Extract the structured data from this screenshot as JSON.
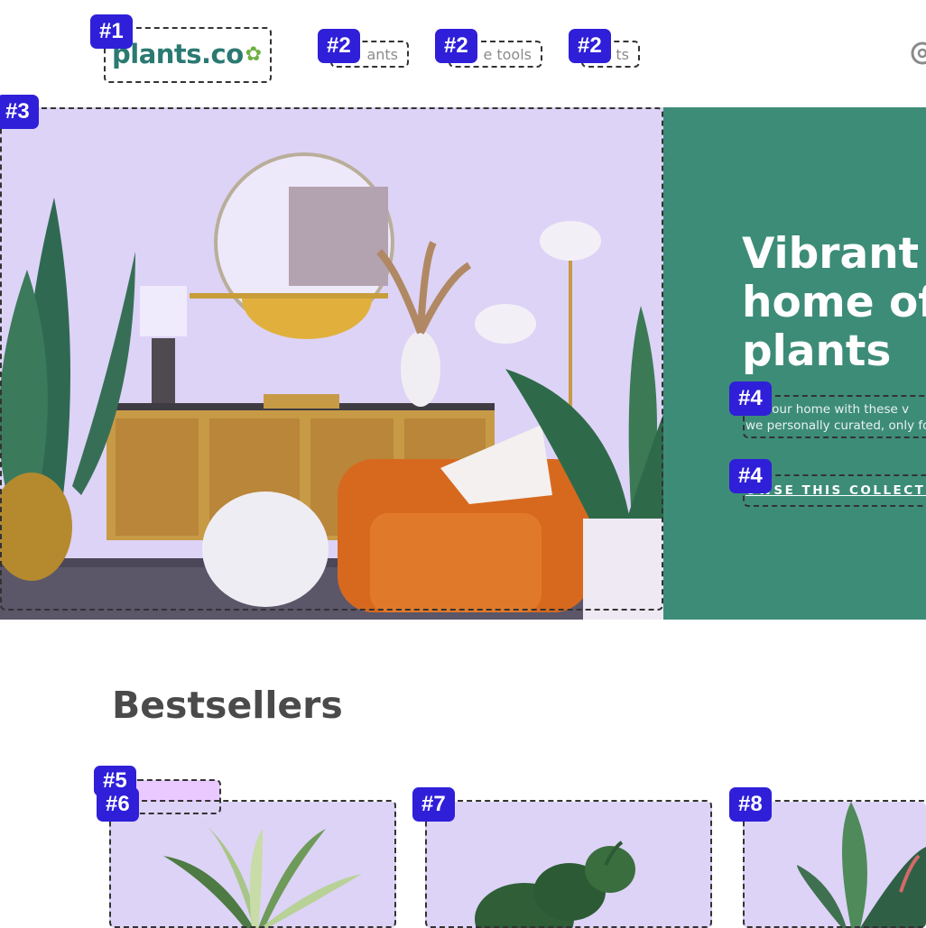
{
  "header": {
    "logo_text": "plants.co",
    "nav": [
      "ants",
      "e tools",
      "ts"
    ]
  },
  "hero": {
    "title": "Vibrant\nhome off\nplants",
    "description": "en your home with these v\nwe personally curated, only for",
    "cta": "OWSE THIS COLLECTI"
  },
  "bestsellers": {
    "title": "Bestsellers"
  },
  "badges": [
    "#1",
    "#2",
    "#2",
    "#2",
    "#3",
    "#4",
    "#4",
    "#5",
    "#6",
    "#7",
    "#8"
  ],
  "colors": {
    "brand": "#2b7a72",
    "hero_panel": "#3d8c78",
    "badge": "#2f1fd8",
    "overlay": "#ddd3f6",
    "tag": "#e9c9ff"
  }
}
